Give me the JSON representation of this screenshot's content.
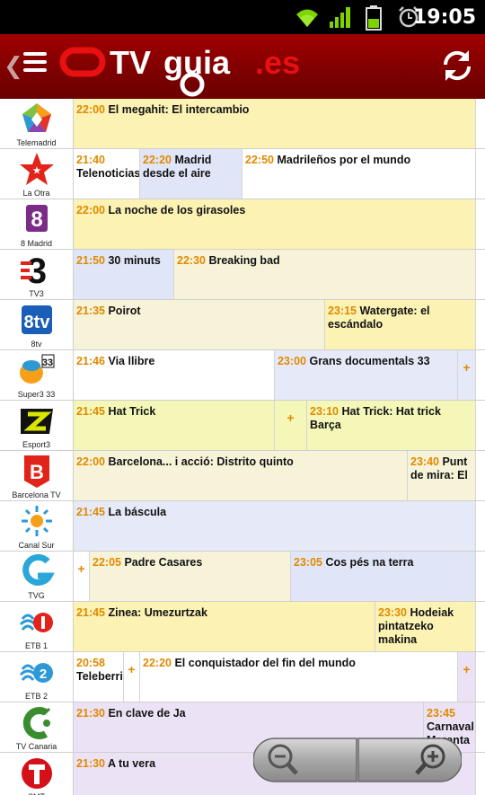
{
  "status": {
    "time": "19:05"
  },
  "app": {
    "back_glyph": "❮",
    "menu_icon": "menu-icon",
    "refresh_icon": "refresh-icon",
    "logo": {
      "part1": "TV",
      "part2": "guia",
      "part3": ".es"
    }
  },
  "colors": {
    "header": "#8a0000",
    "time": "#e08a00",
    "logo_red": "#e81010"
  },
  "rows": [
    {
      "channel": "Telemadrid",
      "programs": [
        {
          "time": "22:00",
          "title": "El megahit: El intercambio"
        }
      ]
    },
    {
      "channel": "La Otra",
      "programs": [
        {
          "time": "21:40",
          "title": "Telenoticias"
        },
        {
          "time": "22:20",
          "title": "Madrid desde el aire"
        },
        {
          "time": "22:50",
          "title": "Madrileños por el mundo"
        }
      ]
    },
    {
      "channel": "8 Madrid",
      "programs": [
        {
          "time": "22:00",
          "title": "La noche de los girasoles"
        }
      ]
    },
    {
      "channel": "TV3",
      "programs": [
        {
          "time": "21:50",
          "title": "30 minuts"
        },
        {
          "time": "22:30",
          "title": "Breaking bad"
        }
      ]
    },
    {
      "channel": "8tv",
      "programs": [
        {
          "time": "21:35",
          "title": "Poirot"
        },
        {
          "time": "23:15",
          "title": "Watergate: el escándalo"
        }
      ]
    },
    {
      "channel": "Super3 33",
      "programs": [
        {
          "time": "21:46",
          "title": "Via llibre"
        },
        {
          "time": "23:00",
          "title": "Grans documentals 33"
        },
        {
          "plus": "+"
        }
      ]
    },
    {
      "channel": "Esport3",
      "programs": [
        {
          "time": "21:45",
          "title": "Hat Trick"
        },
        {
          "plus": "+"
        },
        {
          "time": "23:10",
          "title": "Hat Trick: Hat trick Barça"
        }
      ]
    },
    {
      "channel": "Barcelona TV",
      "programs": [
        {
          "time": "22:00",
          "title": "Barcelona... i acció: Distrito quinto"
        },
        {
          "time": "23:40",
          "title": "Punt de mira: El"
        }
      ]
    },
    {
      "channel": "Canal Sur",
      "programs": [
        {
          "time": "21:45",
          "title": "La báscula"
        }
      ]
    },
    {
      "channel": "TVG",
      "programs": [
        {
          "plus": "+"
        },
        {
          "time": "22:05",
          "title": "Padre Casares"
        },
        {
          "time": "23:05",
          "title": "Cos pés na terra"
        }
      ]
    },
    {
      "channel": "ETB 1",
      "programs": [
        {
          "time": "21:45",
          "title": "Zinea: Umezurtzak"
        },
        {
          "time": "23:30",
          "title": "Hodeiak pintatzeko makina"
        }
      ]
    },
    {
      "channel": "ETB 2",
      "programs": [
        {
          "time": "20:58",
          "title": "Teleberri"
        },
        {
          "plus": "+"
        },
        {
          "time": "22:20",
          "title": "El conquistador del fin del mundo"
        },
        {
          "plus": "+"
        }
      ]
    },
    {
      "channel": "TV Canaria",
      "programs": [
        {
          "time": "21:30",
          "title": "En clave de Ja"
        },
        {
          "time": "23:45",
          "title": "Carnaval Maranta"
        }
      ]
    },
    {
      "channel": "SMT",
      "programs": [
        {
          "time": "21:30",
          "title": "A tu vera"
        }
      ]
    }
  ],
  "zoom": {
    "out_icon": "zoom-out-icon",
    "in_icon": "zoom-in-icon"
  }
}
